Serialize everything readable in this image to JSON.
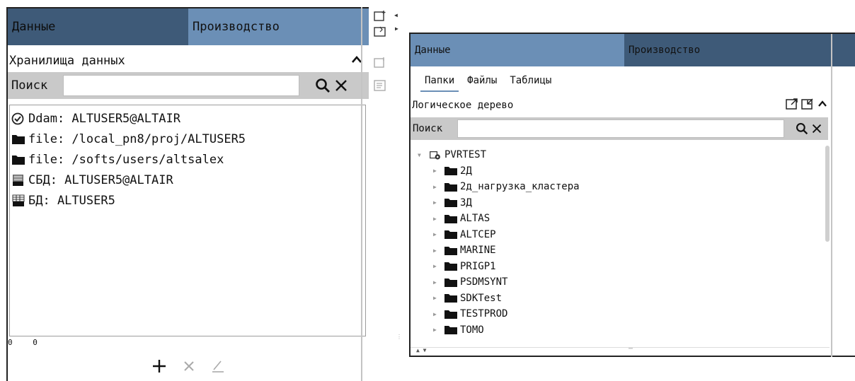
{
  "left": {
    "tabs": [
      {
        "label": "Данные"
      },
      {
        "label": "Производство"
      }
    ],
    "section_title": "Хранилища данных",
    "search": {
      "label": "Поиск",
      "value": ""
    },
    "items": [
      {
        "icon": "check-circle-icon",
        "label": "Ddam: ALTUSER5@ALTAIR"
      },
      {
        "icon": "folder-icon",
        "label": "file: /local_pn8/proj/ALTUSER5"
      },
      {
        "icon": "folder-icon",
        "label": "file: /softs/users/altsalex"
      },
      {
        "icon": "database-sbd-icon",
        "label": "СБД: ALTUSER5@ALTAIR"
      },
      {
        "icon": "database-bd-icon",
        "label": "БД: ALTUSER5"
      }
    ],
    "coords": [
      "0",
      "0"
    ],
    "toolbar": {
      "add": "+",
      "remove": "×",
      "edit": "✎"
    }
  },
  "right": {
    "tabs": [
      {
        "label": "Данные"
      },
      {
        "label": "Производство"
      }
    ],
    "subtabs": [
      {
        "label": "Папки",
        "active": true
      },
      {
        "label": "Файлы"
      },
      {
        "label": "Таблицы"
      }
    ],
    "tree_title": "Логическое дерево",
    "search": {
      "label": "Поиск",
      "value": ""
    },
    "root": "PVRTEST",
    "children": [
      "2Д",
      "2д_нагрузка_кластера",
      "3Д",
      "ALTAS",
      "ALTCEP",
      "MARINE",
      "PRIGP1",
      "PSDMSYNT",
      "SDKTest",
      "TESTPROD",
      "TOMO"
    ]
  },
  "colors": {
    "tab_dark": "#3e5a78",
    "tab_light": "#6b8fb6",
    "search_bar": "#c9c9c9"
  }
}
